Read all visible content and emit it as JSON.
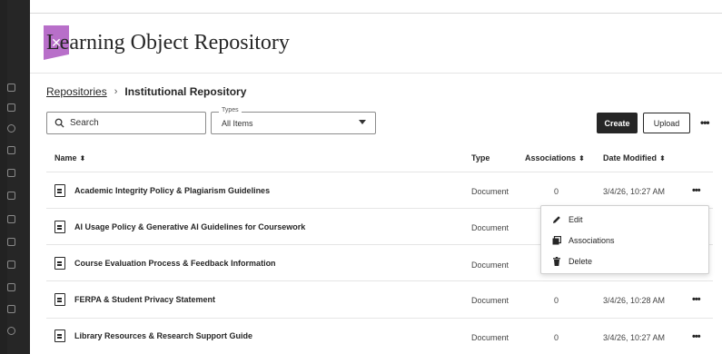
{
  "panel": {
    "close_glyph": "✕",
    "title": "Learning Object Repository"
  },
  "breadcrumb": {
    "parent": "Repositories",
    "separator": "›",
    "current": "Institutional Repository"
  },
  "toolbar": {
    "search_placeholder": "Search",
    "types_legend": "Types",
    "types_value": "All Items",
    "create_label": "Create",
    "upload_label": "Upload",
    "more_glyph": "•••"
  },
  "table": {
    "headers": {
      "name": "Name",
      "type": "Type",
      "associations": "Associations",
      "date": "Date Modified",
      "sort_glyph": "⬍"
    },
    "rows": [
      {
        "name": "Academic Integrity Policy & Plagiarism Guidelines",
        "type": "Document",
        "associations": "0",
        "date": "3/4/26, 10:27 AM",
        "more": "•••"
      },
      {
        "name": "AI Usage Policy & Generative AI Guidelines for Coursework",
        "type": "Document",
        "associations": "",
        "date": "",
        "more": ""
      },
      {
        "name": "Course Evaluation Process & Feedback Information",
        "type": "Document",
        "associations": "",
        "date": "",
        "more": ""
      },
      {
        "name": "FERPA & Student Privacy Statement",
        "type": "Document",
        "associations": "0",
        "date": "3/4/26, 10:28 AM",
        "more": "•••"
      },
      {
        "name": "Library Resources & Research Support Guide",
        "type": "Document",
        "associations": "0",
        "date": "3/4/26, 10:27 AM",
        "more": "•••"
      }
    ]
  },
  "context_menu": {
    "edit": "Edit",
    "associations": "Associations",
    "delete": "Delete"
  },
  "colors": {
    "accent": "#b86fc9",
    "dark": "#262626",
    "rail": "#262626"
  },
  "icons": [
    "close-icon",
    "search-icon",
    "chevron-down-icon",
    "sort-icon",
    "document-icon",
    "more-icon",
    "pencil-icon",
    "associations-icon",
    "trash-icon"
  ]
}
